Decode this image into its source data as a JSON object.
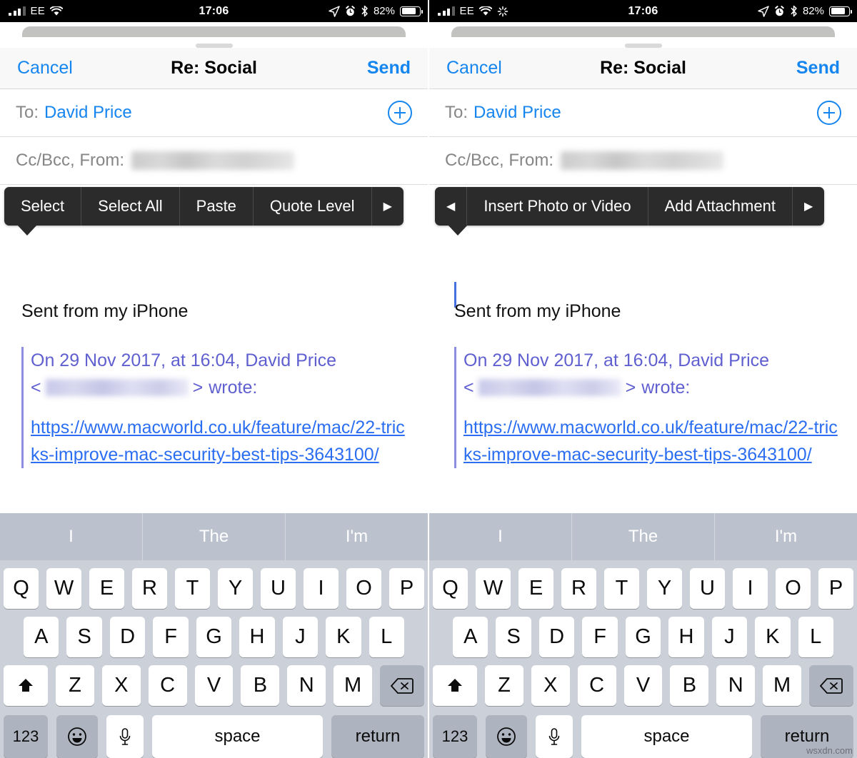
{
  "statusbar": {
    "carrier": "EE",
    "time": "17:06",
    "battery_pct": "82%",
    "icons_left": [
      "signal-bars-icon",
      "wifi-icon"
    ],
    "icons_left_right_panel": [
      "signal-bars-icon",
      "wifi-icon",
      "activity-spinner-icon"
    ],
    "icons_right": [
      "location-arrow-icon",
      "alarm-clock-icon",
      "bluetooth-icon",
      "battery-icon"
    ]
  },
  "navbar": {
    "cancel_label": "Cancel",
    "title": "Re: Social",
    "send_label": "Send"
  },
  "fields": {
    "to_label": "To:",
    "to_value": "David Price",
    "add_contact_icon": "plus-circle-icon",
    "ccbcc_label": "Cc/Bcc, From:",
    "ccbcc_value_redacted": true
  },
  "context_menu_left": {
    "items": [
      "Select",
      "Select All",
      "Paste",
      "Quote Level"
    ],
    "next_arrow": "▶"
  },
  "context_menu_right": {
    "prev_arrow": "◀",
    "items": [
      "Insert Photo or Video",
      "Add Attachment"
    ],
    "next_arrow": "▶"
  },
  "body": {
    "signature": "Sent from my iPhone",
    "quote_line1": "On 29 Nov 2017, at 16:04, David Price",
    "quote_bracket_open": "<",
    "quote_bracket_close": ">",
    "quote_wrote": "wrote:",
    "link": "https://www.macworld.co.uk/feature/mac/22-tricks-improve-mac-security-best-tips-3643100/"
  },
  "keyboard": {
    "predictions": [
      "I",
      "The",
      "I'm"
    ],
    "row1": [
      "Q",
      "W",
      "E",
      "R",
      "T",
      "Y",
      "U",
      "I",
      "O",
      "P"
    ],
    "row2": [
      "A",
      "S",
      "D",
      "F",
      "G",
      "H",
      "J",
      "K",
      "L"
    ],
    "row3": [
      "Z",
      "X",
      "C",
      "V",
      "B",
      "N",
      "M"
    ],
    "shift_icon": "shift-arrow-icon",
    "delete_icon": "backspace-icon",
    "numbers_label": "123",
    "emoji_icon": "smiley-face-icon",
    "mic_icon": "microphone-icon",
    "space_label": "space",
    "return_label": "return"
  },
  "watermark": "wsxdn.com",
  "colors": {
    "accent_blue": "#1585ef",
    "link_blue": "#2b6ef2",
    "quote_purple": "#5f5fd0",
    "menu_bg": "#2b2b2b",
    "keyboard_bg": "#ccd0d8",
    "predict_bg": "#bcc2cd",
    "key_dark": "#aeb4bf"
  }
}
